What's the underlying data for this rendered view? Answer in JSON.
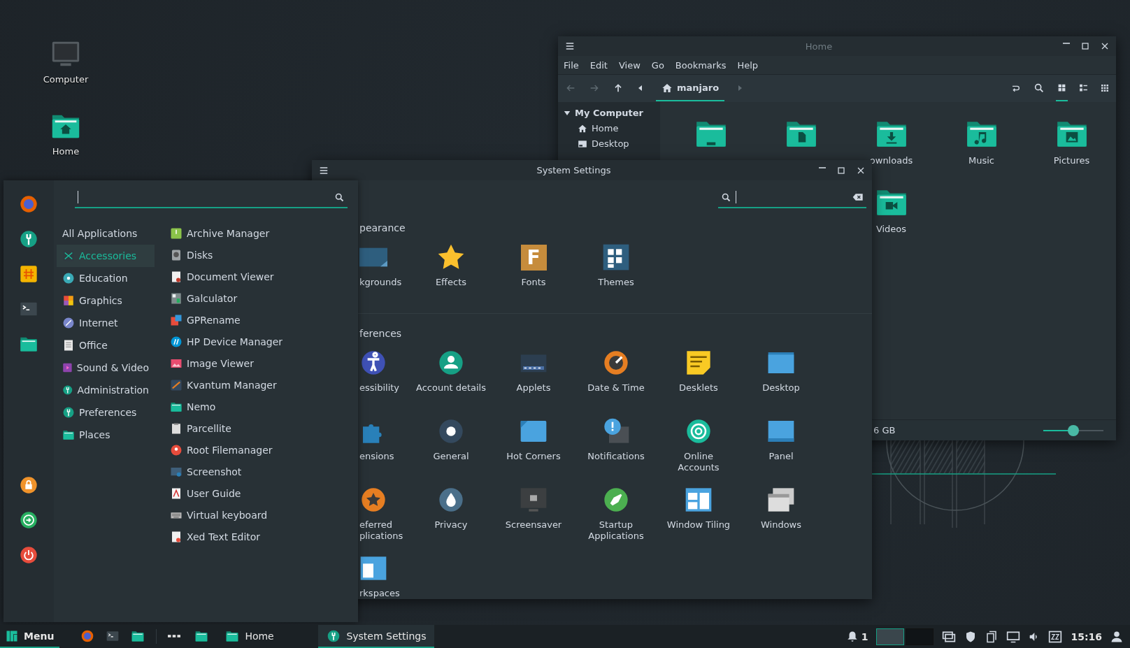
{
  "desktop_icons": [
    {
      "label": "Computer",
      "kind": "computer"
    },
    {
      "label": "Home",
      "kind": "home-folder"
    }
  ],
  "file_manager": {
    "title": "Home",
    "menu": [
      "File",
      "Edit",
      "View",
      "Go",
      "Bookmarks",
      "Help"
    ],
    "location": "manjaro",
    "view_modes": [
      {
        "kind": "grid",
        "selected": true
      },
      {
        "kind": "list",
        "selected": false
      },
      {
        "kind": "compact",
        "selected": false
      }
    ],
    "sidebar": {
      "heading": "My Computer",
      "expanded": true,
      "items": [
        {
          "label": "Home",
          "kind": "home"
        },
        {
          "label": "Desktop",
          "kind": "desktop"
        }
      ]
    },
    "items": [
      {
        "kind": "desktop-folder"
      },
      {
        "kind": "documents"
      },
      {
        "kind": "downloads",
        "label": "ownloads"
      },
      {
        "kind": "music",
        "label": "Music"
      },
      {
        "kind": "pictures",
        "label": "Pictures"
      },
      {
        "kind": "videos",
        "label": "Videos"
      }
    ],
    "status": "6 GB",
    "zoom": {
      "level": 0.5
    }
  },
  "settings": {
    "title": "System Settings",
    "sections": [
      {
        "title": "pearance",
        "items": [
          {
            "label": "kgrounds",
            "kind": "backgrounds"
          },
          {
            "label": "Effects",
            "kind": "effects"
          },
          {
            "label": "Fonts",
            "kind": "fonts",
            "glyph": "F"
          },
          {
            "label": "Themes",
            "kind": "themes"
          }
        ]
      },
      {
        "title": "ferences",
        "items": [
          {
            "label": "essibility",
            "kind": "accessibility"
          },
          {
            "label": "Account details",
            "kind": "account"
          },
          {
            "label": "Applets",
            "kind": "applets"
          },
          {
            "label": "Date & Time",
            "kind": "clock"
          },
          {
            "label": "Desklets",
            "kind": "desklets"
          },
          {
            "label": "Desktop",
            "kind": "desktop"
          },
          {
            "label": "ensions",
            "kind": "extensions"
          },
          {
            "label": "General",
            "kind": "general"
          },
          {
            "label": "Hot Corners",
            "kind": "hotcorners"
          },
          {
            "label": "Notifications",
            "kind": "notifications"
          },
          {
            "label": "Online\nAccounts",
            "kind": "online"
          },
          {
            "label": "Panel",
            "kind": "panel"
          },
          {
            "label": "eferred\nplications",
            "kind": "preferred"
          },
          {
            "label": "Privacy",
            "kind": "privacy"
          },
          {
            "label": "Screensaver",
            "kind": "screensaver"
          },
          {
            "label": "Startup\nApplications",
            "kind": "startup"
          },
          {
            "label": "Window Tiling",
            "kind": "tiling"
          },
          {
            "label": "Windows",
            "kind": "windows"
          },
          {
            "label": "rkspaces",
            "kind": "workspaces"
          }
        ]
      }
    ]
  },
  "menu": {
    "favorites": [
      {
        "kind": "firefox"
      },
      {
        "kind": "settings"
      },
      {
        "kind": "chat"
      },
      {
        "kind": "terminal"
      },
      {
        "kind": "files"
      }
    ],
    "session": [
      {
        "kind": "lock"
      },
      {
        "kind": "logout"
      },
      {
        "kind": "power"
      }
    ],
    "categories": [
      {
        "label": "All Applications",
        "selected": false
      },
      {
        "label": "Accessories",
        "kind": "accessories",
        "selected": true
      },
      {
        "label": "Education",
        "kind": "education",
        "selected": false
      },
      {
        "label": "Graphics",
        "kind": "graphics",
        "selected": false
      },
      {
        "label": "Internet",
        "kind": "internet",
        "selected": false
      },
      {
        "label": "Office",
        "kind": "office",
        "selected": false
      },
      {
        "label": "Sound & Video",
        "kind": "media",
        "selected": false
      },
      {
        "label": "Administration",
        "kind": "settings",
        "selected": false
      },
      {
        "label": "Preferences",
        "kind": "settings",
        "selected": false
      },
      {
        "label": "Places",
        "kind": "files",
        "selected": false
      }
    ],
    "apps": [
      {
        "label": "Archive Manager",
        "kind": "archive"
      },
      {
        "label": "Disks",
        "kind": "disk"
      },
      {
        "label": "Document Viewer",
        "kind": "document"
      },
      {
        "label": "Galculator",
        "kind": "calculator"
      },
      {
        "label": "GPRename",
        "kind": "rename"
      },
      {
        "label": "HP Device Manager",
        "kind": "printer"
      },
      {
        "label": "Image Viewer",
        "kind": "image"
      },
      {
        "label": "Kvantum Manager",
        "kind": "palette"
      },
      {
        "label": "Nemo",
        "kind": "files"
      },
      {
        "label": "Parcellite",
        "kind": "clipboard"
      },
      {
        "label": "Root Filemanager",
        "kind": "root"
      },
      {
        "label": "Screenshot",
        "kind": "screenshot"
      },
      {
        "label": "User Guide",
        "kind": "pdf"
      },
      {
        "label": "Virtual keyboard",
        "kind": "keyboard"
      },
      {
        "label": "Xed Text Editor",
        "kind": "editor"
      }
    ]
  },
  "taskbar": {
    "menu_label": "Menu",
    "launchers": [
      {
        "kind": "firefox"
      },
      {
        "kind": "terminal"
      },
      {
        "kind": "files"
      }
    ],
    "tasks": [
      {
        "kind": "files",
        "selected": false
      },
      {
        "label": "Home",
        "kind": "files",
        "selected": false
      },
      {
        "label": "System Settings",
        "kind": "settings",
        "selected": true
      }
    ],
    "notification_count": "1",
    "workspaces": [
      {
        "selected": true
      },
      {
        "selected": false
      }
    ],
    "clock": "15:16"
  }
}
